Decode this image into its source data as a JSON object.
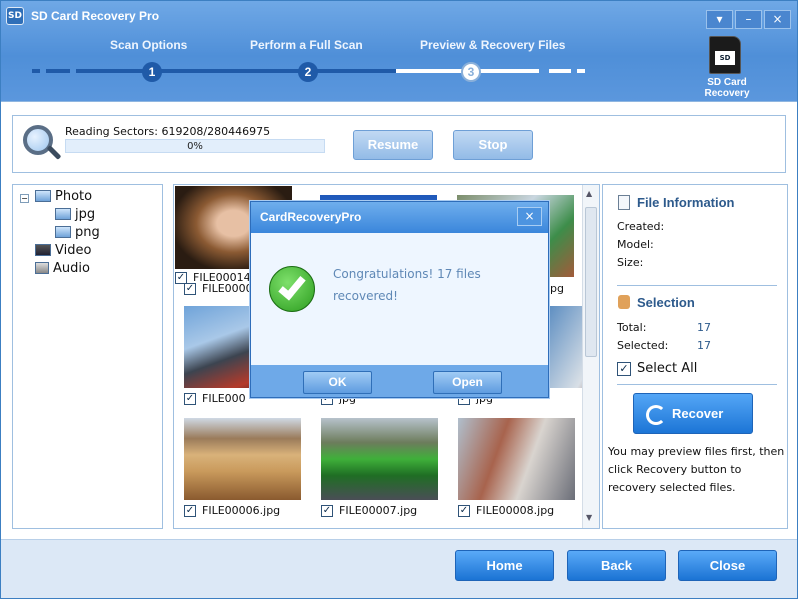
{
  "window": {
    "title": "SD Card Recovery Pro",
    "controls": {
      "menu": "▾",
      "minimize": "–",
      "close": "×"
    }
  },
  "steps": [
    {
      "label": "Scan Options",
      "number": "1"
    },
    {
      "label": "Perform a Full Scan",
      "number": "2"
    },
    {
      "label": "Preview & Recovery Files",
      "number": "3"
    }
  ],
  "product": {
    "badge": "SD",
    "caption_line1": "SD Card",
    "caption_line2": "Recovery"
  },
  "status": {
    "reading": "Reading Sectors: 619208/280446975",
    "progress_text": "0%",
    "progress": 0,
    "resume": "Resume",
    "stop": "Stop"
  },
  "tree": {
    "photo": "Photo",
    "jpg": "jpg",
    "png": "png",
    "video": "Video",
    "audio": "Audio"
  },
  "files": [
    {
      "name": "FILE00014",
      "checked": true
    },
    {
      "name": "FILE0000",
      "checked": true
    },
    {
      "name": "",
      "checked": true
    },
    {
      "name": "FILE00006.jpg",
      "checked": true
    },
    {
      "name": "FILE00007.jpg",
      "checked": true
    },
    {
      "name": "FILE00008.jpg",
      "checked": true
    }
  ],
  "file_captions_partial": {
    "row1_col3": "pg",
    "row2_col1": "FILE000",
    "row2_col2_suffix": "jpg",
    "row2_col3": "jpg"
  },
  "info": {
    "heading": "File Information",
    "created_label": "Created:",
    "model_label": "Model:",
    "size_label": "Size:",
    "selection_heading": "Selection",
    "total_label": "Total:",
    "total_value": "17",
    "selected_label": "Selected:",
    "selected_value": "17",
    "select_all": "Select All",
    "recover": "Recover",
    "note": "You may preview files first, then click Recovery button to recovery selected files."
  },
  "bottom": {
    "home": "Home",
    "back": "Back",
    "close": "Close"
  },
  "dialog": {
    "title": "CardRecoveryPro",
    "message": "Congratulations! 17 files recovered!",
    "ok": "OK",
    "open": "Open",
    "close": "×"
  },
  "colors": {
    "accent": "#1c75d6",
    "header": "#5b97dd",
    "link_text": "#2d5a8c"
  }
}
